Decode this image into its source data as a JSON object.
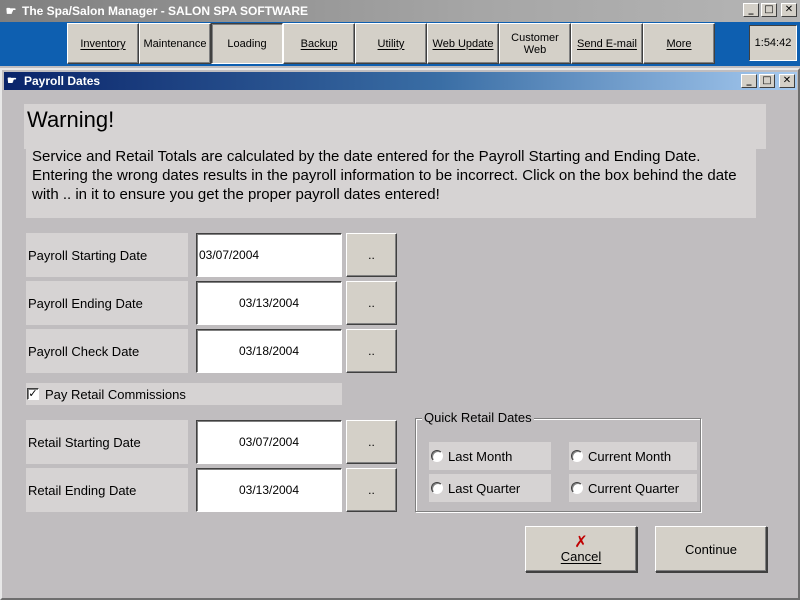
{
  "app": {
    "title": "The Spa/Salon Manager - SALON SPA SOFTWARE",
    "icon": "pointing-hand-icon",
    "controls": {
      "minimize": "_",
      "maximize": "□",
      "close": "✕"
    }
  },
  "toolbar": {
    "items": [
      {
        "label": "Inventory"
      },
      {
        "label": "Maintenance"
      },
      {
        "label": "Loading"
      },
      {
        "label": "Backup"
      },
      {
        "label": "Utility"
      },
      {
        "label": "Web Update"
      },
      {
        "label": "Customer Web"
      },
      {
        "label": "Send E-mail"
      },
      {
        "label": "More"
      }
    ],
    "clock": "1:54:42",
    "accent": "#0e5fb0"
  },
  "window": {
    "title": "Payroll Dates",
    "icon": "pointing-hand-icon"
  },
  "warning": {
    "title": "Warning!",
    "text": "Service and Retail Totals are calculated by the date entered for the Payroll Starting and Ending Date.  Entering the wrong dates results in the payroll information to be incorrect.  Click on the box behind the date with .. in it to ensure you get the proper payroll dates entered!"
  },
  "fields": {
    "payroll_start": {
      "label": "Payroll Starting Date",
      "value": "03/07/2004",
      "picker": ".."
    },
    "payroll_end": {
      "label": "Payroll Ending Date",
      "value": "03/13/2004",
      "picker": ".."
    },
    "payroll_check": {
      "label": "Payroll Check Date",
      "value": "03/18/2004",
      "picker": ".."
    },
    "retail_start": {
      "label": "Retail Starting Date",
      "value": "03/07/2004",
      "picker": ".."
    },
    "retail_end": {
      "label": "Retail Ending Date",
      "value": "03/13/2004",
      "picker": ".."
    }
  },
  "pay_retail": {
    "label": "Pay Retail Commissions",
    "checked": true,
    "mark": "✓"
  },
  "quick_retail": {
    "legend": "Quick Retail Dates",
    "options": [
      {
        "label": "Last Month"
      },
      {
        "label": "Current Month"
      },
      {
        "label": "Last Quarter"
      },
      {
        "label": "Current Quarter"
      }
    ]
  },
  "buttons": {
    "cancel": {
      "label": "Cancel",
      "icon": "red-x-icon",
      "glyph": "✗"
    },
    "continue": {
      "label": "Continue"
    }
  }
}
